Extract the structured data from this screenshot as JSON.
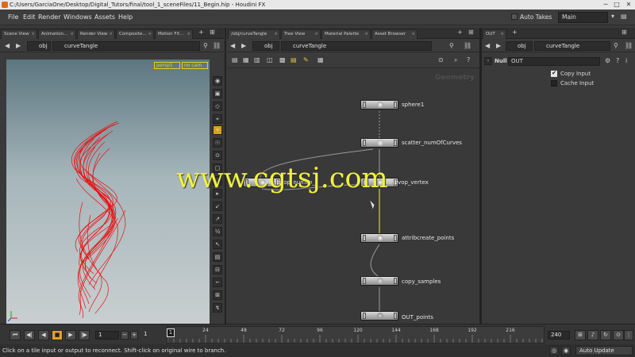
{
  "window": {
    "title": "C:/Users/GarciaOne/Desktop/Digital_Tutors/final/tool_1_sceneFiles/11_Begin.hip - Houdini FX",
    "minimize": "─",
    "maximize": "□",
    "close": "✕"
  },
  "menu": {
    "items": [
      "File",
      "Edit",
      "Render",
      "Windows",
      "Assets",
      "Help"
    ],
    "auto_takes_label": "Auto Takes",
    "desktop": "Main"
  },
  "left_pane": {
    "tabs": [
      "Scene View",
      "Animation...",
      "Render View",
      "Composite...",
      "Motion FX..."
    ],
    "path_root": "obj",
    "path_node": "curveTangle",
    "camera_menu": "persp1",
    "cam_menu2": "no cam"
  },
  "center_pane": {
    "tabs": [
      "/obj/curveTangle",
      "Tree View",
      "Material Palette",
      "Asset Browser"
    ],
    "path_root": "obj",
    "path_node": "curveTangle",
    "context_label": "Geometry",
    "nodes": [
      {
        "label": "sphere1"
      },
      {
        "label": "scatter_numOfCurves"
      },
      {
        "label": "attribvop_numPo_1"
      },
      {
        "label": "attribvop_vertex"
      },
      {
        "label": "attribcreate_points"
      },
      {
        "label": "copy_samples"
      },
      {
        "label": "OUT_points"
      }
    ]
  },
  "watermark": "www.cgtsj.com",
  "right_pane": {
    "tab": "OUT",
    "path_root": "obj",
    "path_node": "curveTangle",
    "node_type": "Null",
    "node_name": "OUT",
    "params": [
      {
        "label": "Copy Input",
        "checked": true
      },
      {
        "label": "Cache Input",
        "checked": false
      }
    ]
  },
  "timeline": {
    "current_frame": "1",
    "start_frame": "1",
    "end_frame": "240",
    "frame_marker": "1",
    "ticks": [
      "24",
      "48",
      "72",
      "96",
      "120",
      "144",
      "168",
      "192",
      "216"
    ],
    "minus": "−",
    "plus": "+"
  },
  "status": {
    "message": "Click on a tile input or output to reconnect. Shift-click on original wire to branch.",
    "update_mode": "Auto Update"
  },
  "colors": {
    "curves": "#e81010",
    "watermark": "#f1f23a",
    "wire_selected": "#d8d820"
  }
}
